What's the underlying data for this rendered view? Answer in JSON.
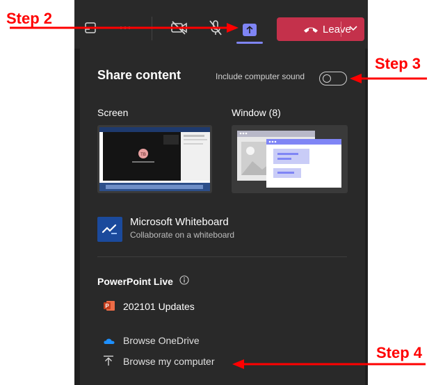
{
  "toolbar": {
    "leave_label": "Leave"
  },
  "share": {
    "title": "Share content",
    "sound_label": "Include computer sound",
    "sound_on": false,
    "screen_label": "Screen",
    "window_label": "Window (8)",
    "whiteboard_title": "Microsoft Whiteboard",
    "whiteboard_sub": "Collaborate on a whiteboard",
    "ppt_heading": "PowerPoint Live",
    "ppt_file": "202101 Updates",
    "onedrive": "Browse OneDrive",
    "computer": "Browse my computer",
    "screen_thumb_initials": "TB"
  },
  "annotations": {
    "step2": "Step 2",
    "step3": "Step 3",
    "step4": "Step 4"
  },
  "colors": {
    "accent": "#7f85f5",
    "leave": "#c4314b",
    "arrow": "#ff0000"
  }
}
